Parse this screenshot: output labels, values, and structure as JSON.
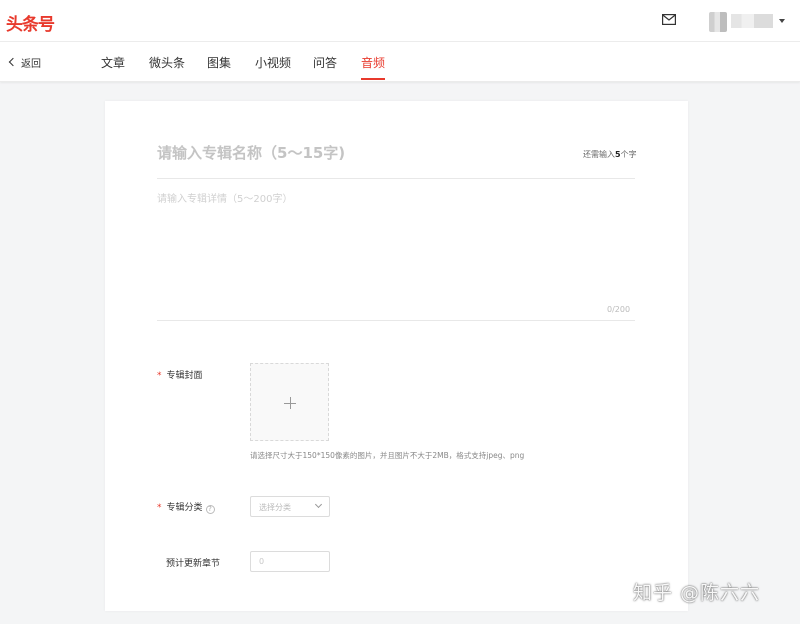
{
  "header": {
    "logo": "头条号",
    "icons": {
      "mail": "mail-icon",
      "caret": "caret-down-icon"
    },
    "brand_color": "#e8392c"
  },
  "nav": {
    "back_label": "返回",
    "tabs": [
      {
        "label": "文章",
        "active": false
      },
      {
        "label": "微头条",
        "active": false
      },
      {
        "label": "图集",
        "active": false
      },
      {
        "label": "小视频",
        "active": false
      },
      {
        "label": "问答",
        "active": false
      },
      {
        "label": "音频",
        "active": true
      }
    ]
  },
  "form": {
    "name_placeholder": "请输入专辑名称（5～15字)",
    "counter_prefix": "还需输入",
    "counter_value": "5",
    "counter_suffix": "个字",
    "desc_placeholder": "请输入专辑详情（5～200字）",
    "desc_count": "0/200",
    "cover_label": "专辑封面",
    "cover_hint": "请选择尺寸大于150*150像素的图片，并且图片不大于2MB，格式支持jpeg、png",
    "category_label": "专辑分类",
    "category_placeholder": "选择分类",
    "chapters_label": "预计更新章节",
    "chapters_placeholder": "0",
    "required_mark": "*"
  },
  "watermark": "知乎 @陈六六"
}
